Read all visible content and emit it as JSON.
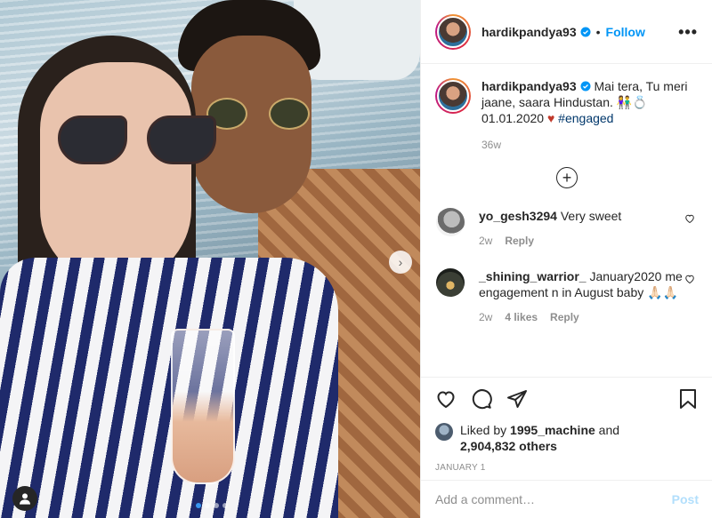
{
  "post": {
    "username": "hardikpandya93",
    "separator": "•",
    "follow_label": "Follow",
    "more_icon": "more-options-icon",
    "more_label": "•••",
    "caption": {
      "username": "hardikpandya93",
      "text": " Mai tera, Tu meri jaane, saara Hindustan. 👫💍",
      "date_line": "01.01.2020 ",
      "heart": "♥",
      "hashtag": "#engaged"
    },
    "caption_age": "36w",
    "load_more_label": "+"
  },
  "comments": [
    {
      "username": "yo_gesh3294",
      "text": " Very sweet",
      "age": "2w",
      "likes": "",
      "reply_label": "Reply"
    },
    {
      "username": "_shining_warrior_",
      "text": " January2020 me engagement n in August baby 🙏🏻🙏🏻",
      "age": "2w",
      "likes": "4 likes",
      "reply_label": "Reply"
    }
  ],
  "likes": {
    "prefix": "Liked by ",
    "user": "1995_machine",
    "middle": " and",
    "count": "2,904,832 others"
  },
  "post_date": "JANUARY 1",
  "add_comment": {
    "placeholder": "Add a comment…",
    "post_label": "Post"
  },
  "carousel": {
    "index": 1,
    "total": 4,
    "next_label": "›"
  },
  "colors": {
    "accent": "#0095f6",
    "post_disabled": "#b2dffc",
    "heart": "#c0392b",
    "hashtag": "#00376b",
    "muted": "#8e8e8e"
  }
}
